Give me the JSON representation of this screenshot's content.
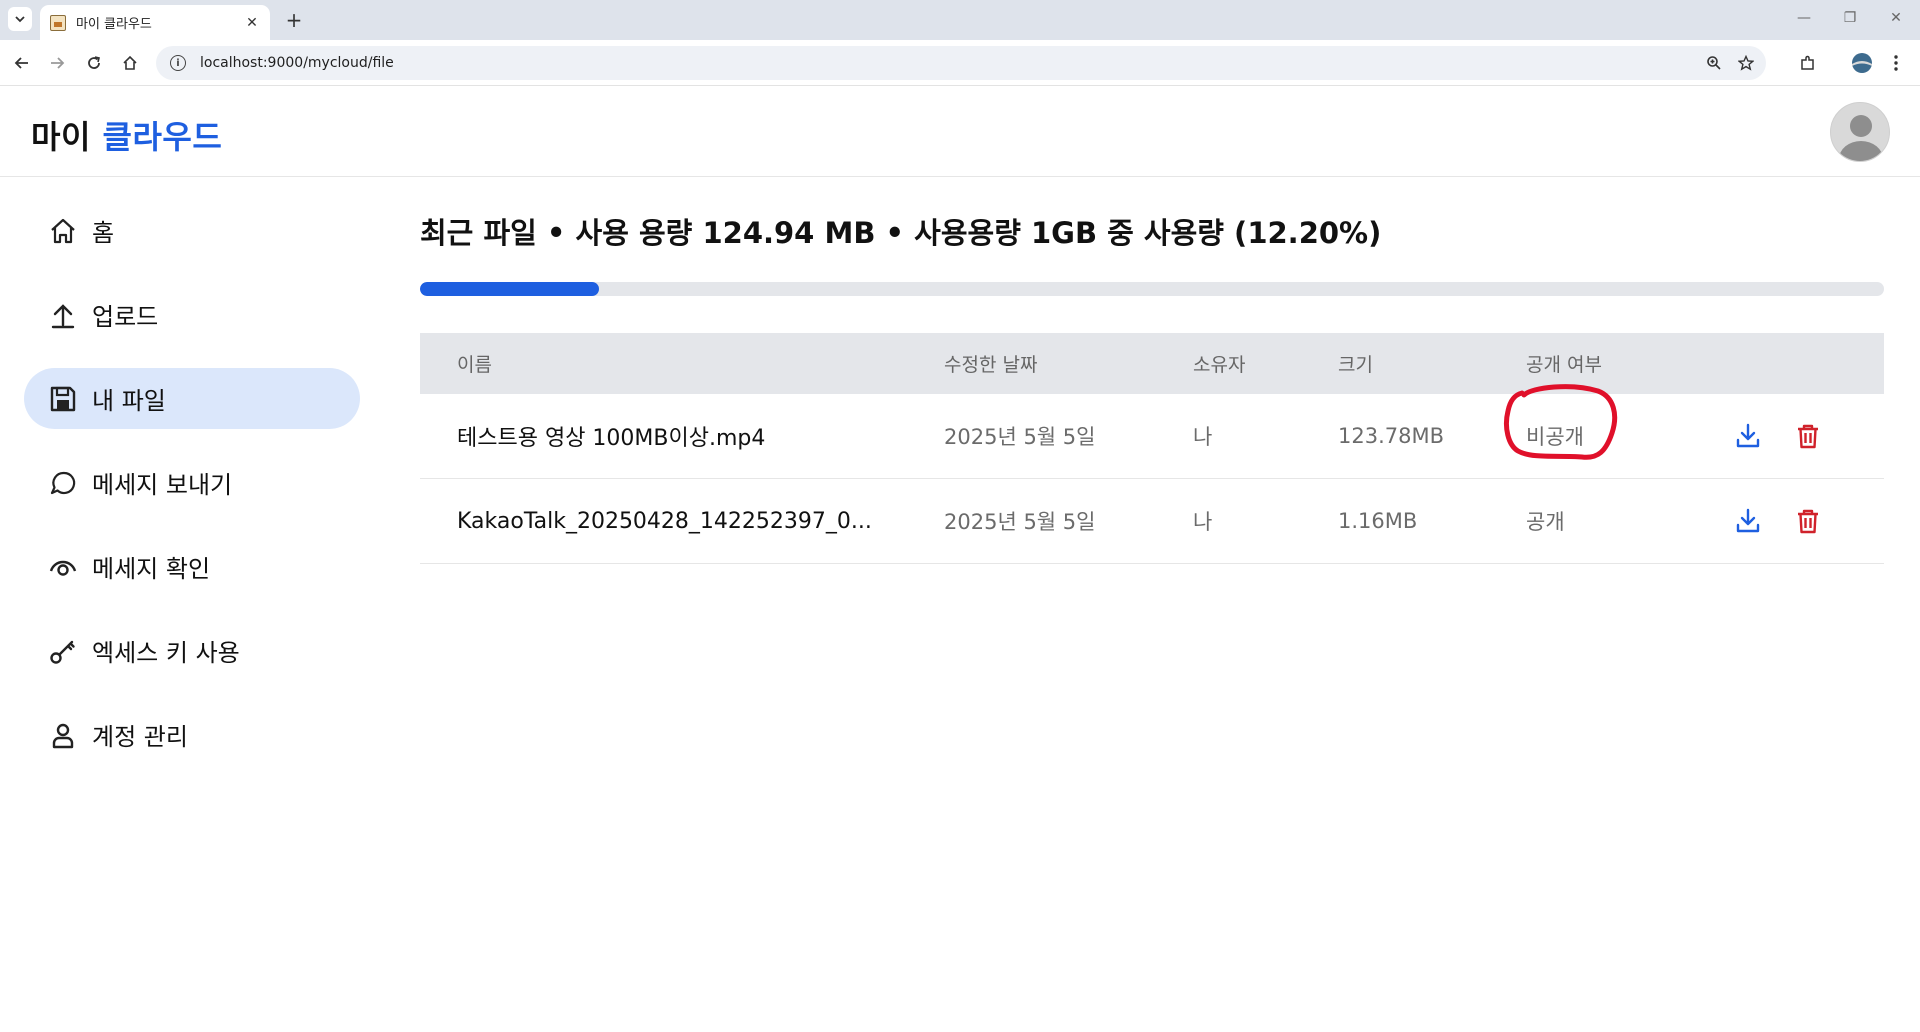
{
  "browser": {
    "tab_title": "마이 클라우드",
    "url": "localhost:9000/mycloud/file"
  },
  "app": {
    "brand_part1": "마이",
    "brand_part2": "클라우드"
  },
  "sidebar": {
    "items": [
      {
        "label": "홈",
        "icon": "home-icon"
      },
      {
        "label": "업로드",
        "icon": "upload-icon"
      },
      {
        "label": "내 파일",
        "icon": "save-icon",
        "active": true
      },
      {
        "label": "메세지 보내기",
        "icon": "chat-bubble-icon"
      },
      {
        "label": "메세지 확인",
        "icon": "eye-icon"
      },
      {
        "label": "엑세스 키 사용",
        "icon": "key-icon"
      },
      {
        "label": "계정 관리",
        "icon": "user-icon"
      }
    ]
  },
  "main": {
    "headline": "최근 파일 • 사용 용량 124.94 MB • 사용용량 1GB 중 사용량 (12.20%)",
    "usage_percent": 12.2
  },
  "table": {
    "headers": {
      "name": "이름",
      "date": "수정한 날짜",
      "owner": "소유자",
      "size": "크기",
      "public": "공개 여부"
    },
    "rows": [
      {
        "name": "테스트용 영상 100MB이상.mp4",
        "date": "2025년 5월 5일",
        "owner": "나",
        "size": "123.78MB",
        "public": "비공개"
      },
      {
        "name": "KakaoTalk_20250428_142252397_0...",
        "date": "2025년 5월 5일",
        "owner": "나",
        "size": "1.16MB",
        "public": "공개"
      }
    ]
  },
  "colors": {
    "accent": "#1e5fe0",
    "delete": "#d0222b",
    "active_bg": "#dbe7fb",
    "annotation": "#e0102a"
  }
}
